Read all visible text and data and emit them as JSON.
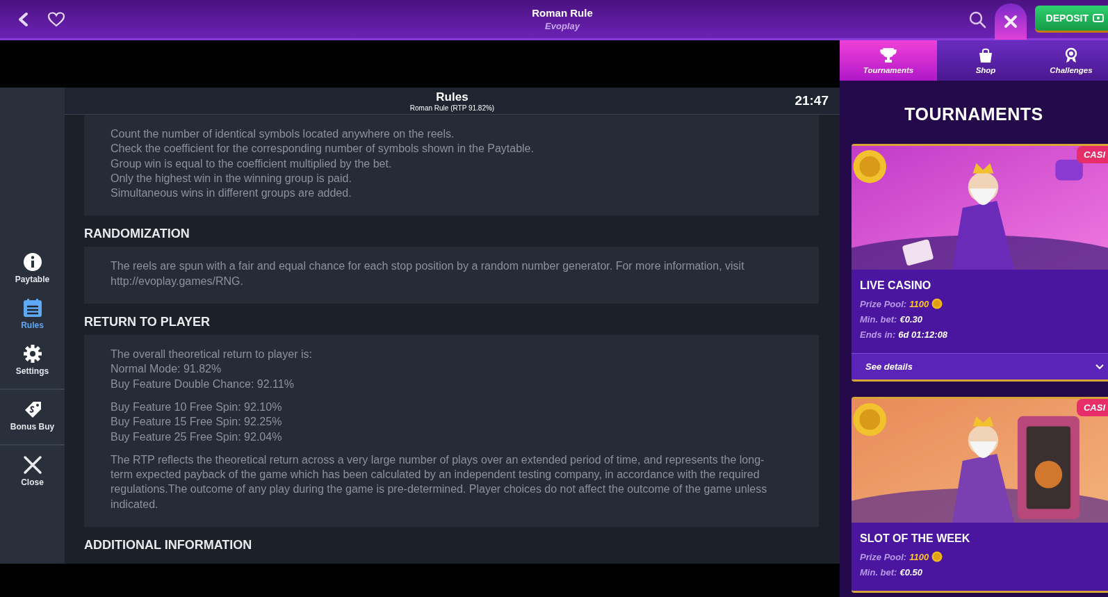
{
  "header": {
    "title": "Roman Rule",
    "subtitle": "Evoplay",
    "deposit": "DEPOSIT"
  },
  "game": {
    "title": "Rules",
    "subtitle": "Roman Rule (RTP 91.82%)",
    "clock": "21:47",
    "sidebar_groups": [
      {
        "items": [
          {
            "label": "Paytable",
            "kind": "info",
            "selected": false
          },
          {
            "label": "Rules",
            "kind": "list",
            "selected": true
          },
          {
            "label": "Settings",
            "kind": "gear",
            "selected": false
          }
        ]
      },
      {
        "items": [
          {
            "label": "Bonus Buy",
            "kind": "tag",
            "selected": false
          }
        ]
      },
      {
        "items": [
          {
            "label": "Close",
            "kind": "close",
            "selected": false
          }
        ]
      }
    ],
    "sections": [
      {
        "blocks": [
          [
            "Count the number of identical symbols located anywhere on the reels.",
            "Check the coefficient for the corresponding number of symbols shown in the Paytable.",
            "Group win is equal to the coefficient multiplied by the bet.",
            "Only the highest win in the winning group is paid.",
            "Simultaneous wins in different groups are added."
          ]
        ]
      },
      {
        "heading": "RANDOMIZATION",
        "blocks": [
          [
            "The reels are spun with a fair and equal chance for each stop position by a random number generator. For more information, visit http://evoplay.games/RNG."
          ]
        ]
      },
      {
        "heading": "RETURN TO PLAYER",
        "blocks": [
          [
            "The overall theoretical return to player is:",
            "Normal Mode: 91.82%",
            "Buy Feature Double Chance: 92.11%"
          ],
          [
            "Buy Feature 10 Free Spin: 92.10%",
            "Buy Feature 15 Free Spin: 92.25%",
            "Buy Feature 25 Free Spin: 92.04%"
          ],
          [
            "The RTP reflects the theoretical return across a very large number of plays over an extended period of time, and represents the long-term expected payback of the game which has been calculated by an independent testing company, in accordance with the required regulations.The outcome of any play during the game is pre-determined. Player choices do not affect the outcome of the game unless indicated."
          ]
        ]
      },
      {
        "heading": "ADDITIONAL INFORMATION"
      }
    ]
  },
  "panel": {
    "tabs": [
      {
        "label": "Tournaments",
        "kind": "trophy",
        "selected": true
      },
      {
        "label": "Shop",
        "kind": "bag",
        "selected": false
      },
      {
        "label": "Challenges",
        "kind": "badge",
        "selected": false
      }
    ],
    "title": "TOURNAMENTS",
    "cards": [
      {
        "badge": "CASI",
        "name": "LIVE CASINO",
        "prize_label": "Prize Pool:",
        "prize": "1100",
        "bet_label": "Min. bet:",
        "bet": "€0.30",
        "ends_label": "Ends in:",
        "ends": "6d 01:12:08",
        "details": "See details"
      },
      {
        "badge": "CASI",
        "name": "SLOT OF THE WEEK",
        "prize_label": "Prize Pool:",
        "prize": "1100",
        "bet_label": "Min. bet:",
        "bet": "€0.50"
      }
    ]
  }
}
